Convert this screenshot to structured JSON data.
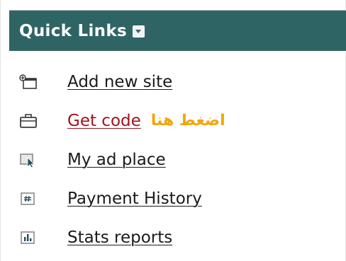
{
  "header": {
    "title": "Quick Links"
  },
  "links": [
    {
      "label": "Add new site",
      "icon": "add-site-icon"
    },
    {
      "label": "Get code",
      "icon": "briefcase-icon",
      "note": "اضغط هنا"
    },
    {
      "label": "My ad place",
      "icon": "cursor-box-icon"
    },
    {
      "label": "Payment History",
      "icon": "payment-grid-icon"
    },
    {
      "label": "Stats reports",
      "icon": "bar-chart-icon"
    }
  ],
  "colors": {
    "header_bg": "#2f6464",
    "get_code_link": "#a0121f",
    "arabic_note": "#f2a60c"
  }
}
